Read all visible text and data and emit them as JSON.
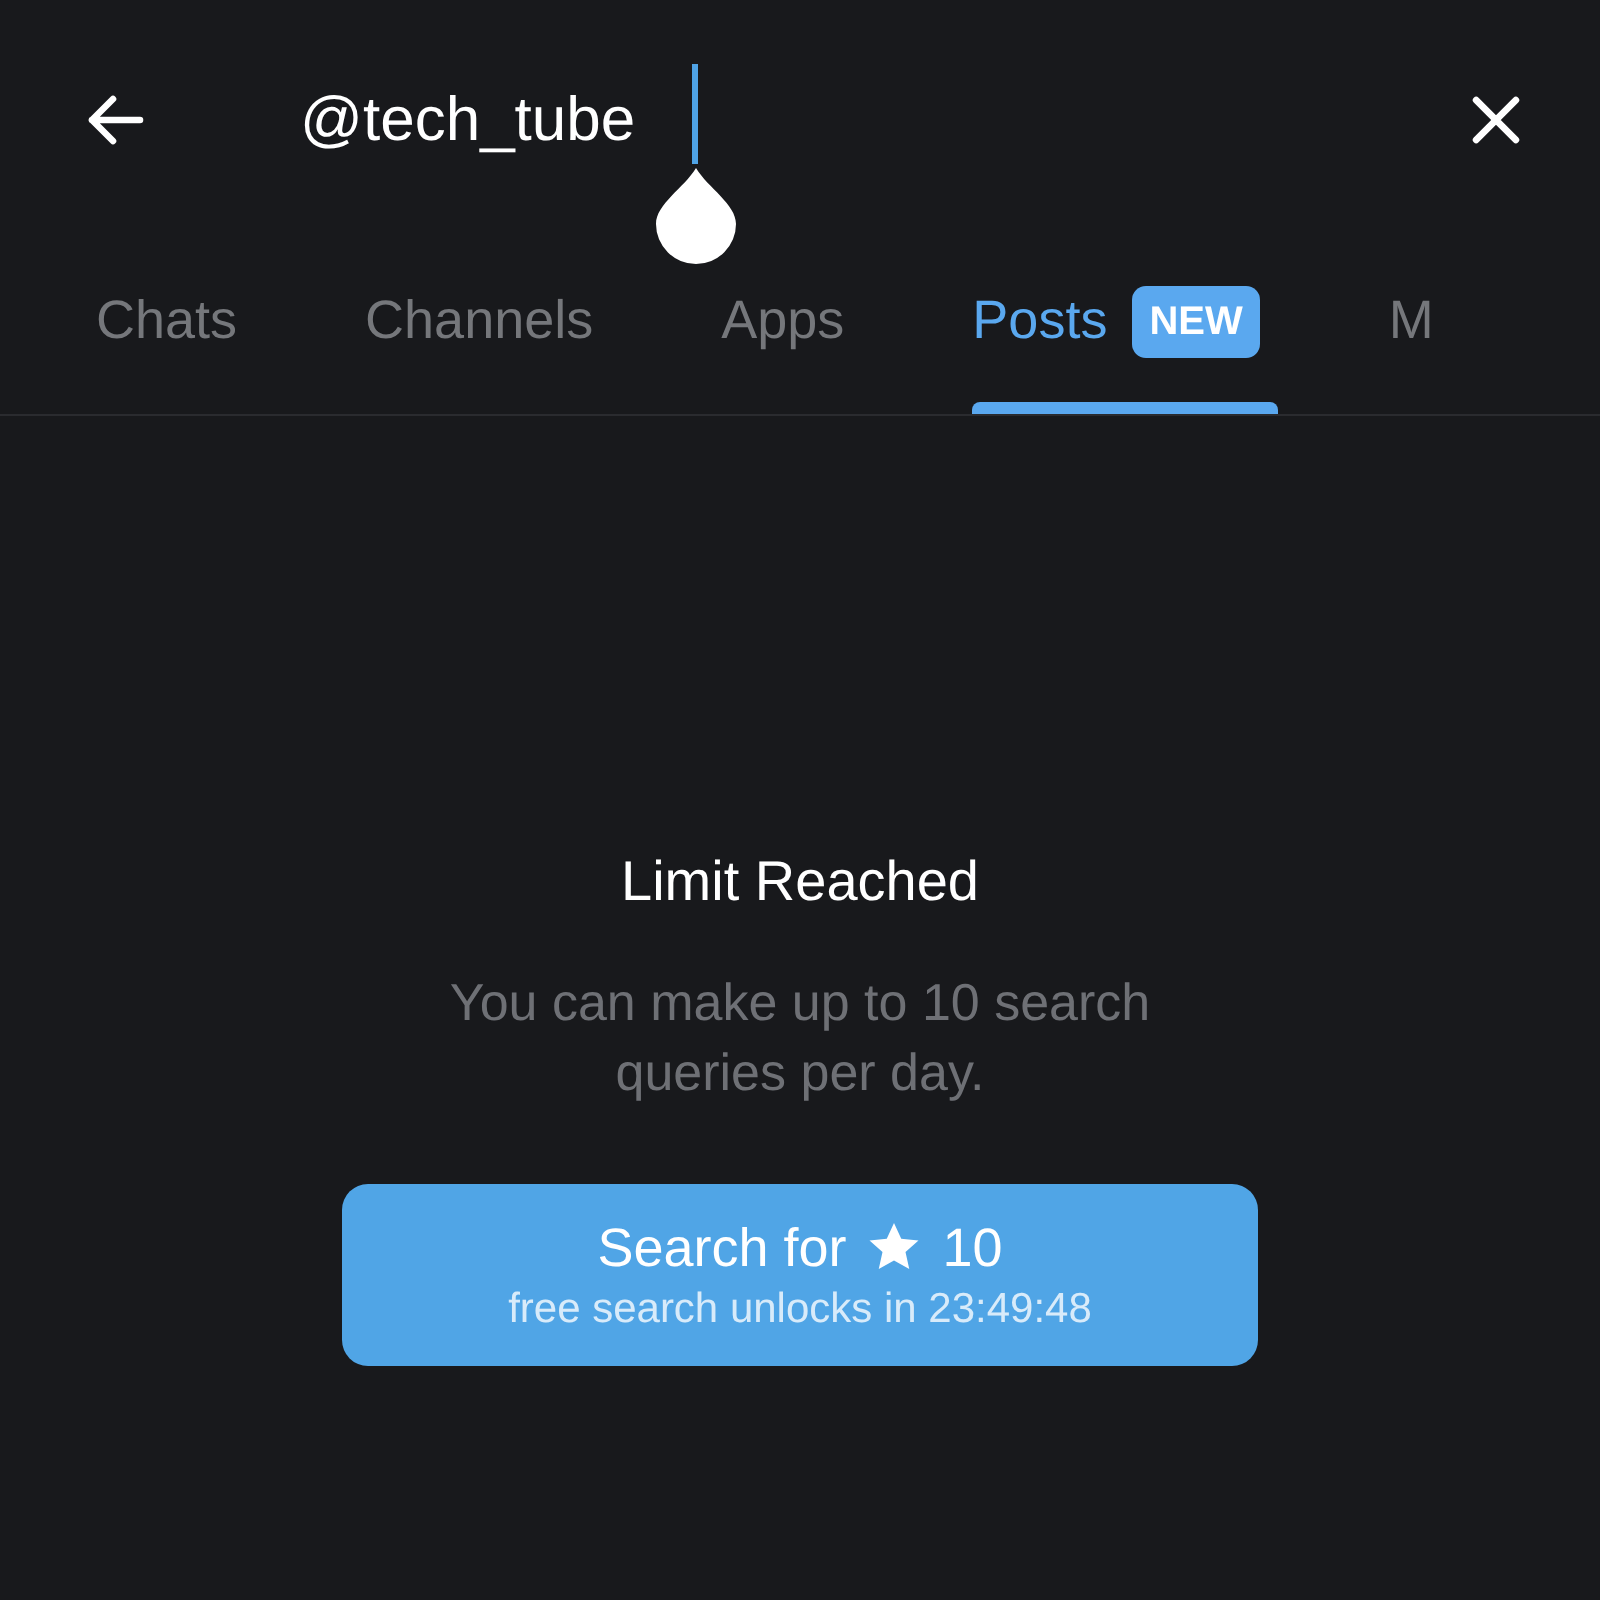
{
  "search": {
    "value": "@tech_tube"
  },
  "tabs": [
    {
      "label": "Chats",
      "selected": false
    },
    {
      "label": "Channels",
      "selected": false
    },
    {
      "label": "Apps",
      "selected": false
    },
    {
      "label": "Posts",
      "selected": true,
      "badge": "NEW"
    },
    {
      "label": "M",
      "selected": false
    }
  ],
  "empty_state": {
    "title": "Limit Reached",
    "message": "You can make up to 10 search queries per day."
  },
  "action_button": {
    "label": "Search for",
    "amount": "10",
    "subtitle": "free search unlocks in 23:49:48"
  }
}
